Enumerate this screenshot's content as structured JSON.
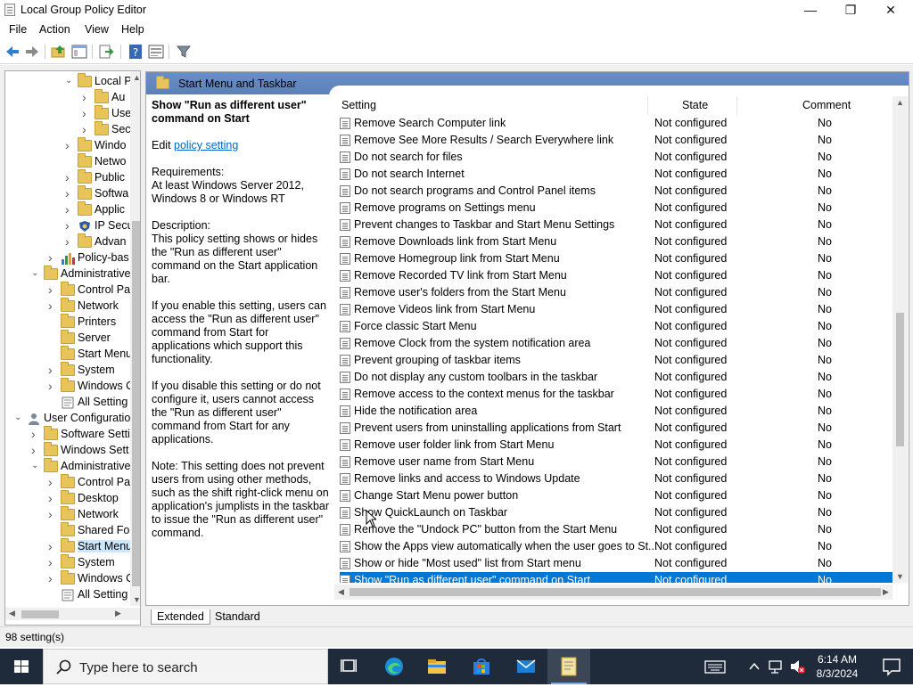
{
  "window": {
    "title": "Local Group Policy Editor",
    "minimize_glyph": "—",
    "maximize_glyph": "❐",
    "close_glyph": "✕"
  },
  "menu": [
    "File",
    "Action",
    "View",
    "Help"
  ],
  "toolbar_icons": [
    "back-icon",
    "forward-icon",
    "up-folder-icon",
    "show-hide-tree-icon",
    "export-list-icon",
    "help-icon",
    "properties-icon",
    "filter-icon"
  ],
  "tree": [
    {
      "label": "Local P",
      "indent": 4,
      "expander": "down",
      "icon": "policy-folder"
    },
    {
      "label": "Au",
      "indent": 5,
      "expander": "right",
      "icon": "lock-folder"
    },
    {
      "label": "Use",
      "indent": 5,
      "expander": "right",
      "icon": "lock-folder"
    },
    {
      "label": "Sec",
      "indent": 5,
      "expander": "right",
      "icon": "lock-folder"
    },
    {
      "label": "Windo",
      "indent": 4,
      "expander": "right",
      "icon": "folder"
    },
    {
      "label": "Netwo",
      "indent": 4,
      "expander": "",
      "icon": "folder"
    },
    {
      "label": "Public",
      "indent": 4,
      "expander": "right",
      "icon": "folder"
    },
    {
      "label": "Softwa",
      "indent": 4,
      "expander": "right",
      "icon": "folder"
    },
    {
      "label": "Applic",
      "indent": 4,
      "expander": "right",
      "icon": "folder"
    },
    {
      "label": "IP Secu",
      "indent": 4,
      "expander": "right",
      "icon": "shield"
    },
    {
      "label": "Advan",
      "indent": 4,
      "expander": "right",
      "icon": "folder"
    },
    {
      "label": "Policy-bas",
      "indent": 3,
      "expander": "right",
      "icon": "chart"
    },
    {
      "label": "Administrative",
      "indent": 2,
      "expander": "down",
      "icon": "folder"
    },
    {
      "label": "Control Pa",
      "indent": 3,
      "expander": "right",
      "icon": "folder"
    },
    {
      "label": "Network",
      "indent": 3,
      "expander": "right",
      "icon": "folder"
    },
    {
      "label": "Printers",
      "indent": 3,
      "expander": "",
      "icon": "folder"
    },
    {
      "label": "Server",
      "indent": 3,
      "expander": "",
      "icon": "folder"
    },
    {
      "label": "Start Menu",
      "indent": 3,
      "expander": "",
      "icon": "folder"
    },
    {
      "label": "System",
      "indent": 3,
      "expander": "right",
      "icon": "folder"
    },
    {
      "label": "Windows C",
      "indent": 3,
      "expander": "right",
      "icon": "folder"
    },
    {
      "label": "All Setting",
      "indent": 3,
      "expander": "",
      "icon": "settings"
    },
    {
      "label": "User Configuration",
      "indent": 1,
      "expander": "down",
      "icon": "user"
    },
    {
      "label": "Software Setti",
      "indent": 2,
      "expander": "right",
      "icon": "folder"
    },
    {
      "label": "Windows Sett",
      "indent": 2,
      "expander": "right",
      "icon": "folder"
    },
    {
      "label": "Administrative",
      "indent": 2,
      "expander": "down",
      "icon": "folder"
    },
    {
      "label": "Control Pa",
      "indent": 3,
      "expander": "right",
      "icon": "folder"
    },
    {
      "label": "Desktop",
      "indent": 3,
      "expander": "right",
      "icon": "folder"
    },
    {
      "label": "Network",
      "indent": 3,
      "expander": "right",
      "icon": "folder"
    },
    {
      "label": "Shared Fol",
      "indent": 3,
      "expander": "",
      "icon": "folder"
    },
    {
      "label": "Start Menu",
      "indent": 3,
      "expander": "right",
      "icon": "folder",
      "selected": true
    },
    {
      "label": "System",
      "indent": 3,
      "expander": "right",
      "icon": "folder"
    },
    {
      "label": "Windows C",
      "indent": 3,
      "expander": "right",
      "icon": "folder"
    },
    {
      "label": "All Setting",
      "indent": 3,
      "expander": "",
      "icon": "settings"
    }
  ],
  "right_header": "Start Menu and Taskbar",
  "description": {
    "title": "Show \"Run as different user\" command on Start",
    "edit_prefix": "Edit",
    "edit_link": "policy setting",
    "requirements": "Requirements:\nAt least Windows Server 2012, Windows 8 or Windows RT",
    "description": "Description:\nThis policy setting shows or hides the \"Run as different user\" command on the Start application bar.",
    "enable": "If you enable this setting, users can access the \"Run as different user\" command from Start for applications which support this functionality.",
    "disable": "If you disable this setting or do not configure it, users cannot access the \"Run as different user\" command from Start for any applications.",
    "note": "Note: This setting does not prevent users from using other methods, such as the shift right-click menu on application's jumplists in the taskbar to issue the \"Run as different user\" command."
  },
  "columns": {
    "setting": "Setting",
    "state": "State",
    "comment": "Comment"
  },
  "settings": [
    {
      "name": "Remove Search Computer link",
      "state": "Not configured",
      "comment": "No"
    },
    {
      "name": "Remove See More Results / Search Everywhere link",
      "state": "Not configured",
      "comment": "No"
    },
    {
      "name": "Do not search for files",
      "state": "Not configured",
      "comment": "No"
    },
    {
      "name": "Do not search Internet",
      "state": "Not configured",
      "comment": "No"
    },
    {
      "name": "Do not search programs and Control Panel items",
      "state": "Not configured",
      "comment": "No"
    },
    {
      "name": "Remove programs on Settings menu",
      "state": "Not configured",
      "comment": "No"
    },
    {
      "name": "Prevent changes to Taskbar and Start Menu Settings",
      "state": "Not configured",
      "comment": "No"
    },
    {
      "name": "Remove Downloads link from Start Menu",
      "state": "Not configured",
      "comment": "No"
    },
    {
      "name": "Remove Homegroup link from Start Menu",
      "state": "Not configured",
      "comment": "No"
    },
    {
      "name": "Remove Recorded TV link from Start Menu",
      "state": "Not configured",
      "comment": "No"
    },
    {
      "name": "Remove user's folders from the Start Menu",
      "state": "Not configured",
      "comment": "No"
    },
    {
      "name": "Remove Videos link from Start Menu",
      "state": "Not configured",
      "comment": "No"
    },
    {
      "name": "Force classic Start Menu",
      "state": "Not configured",
      "comment": "No"
    },
    {
      "name": "Remove Clock from the system notification area",
      "state": "Not configured",
      "comment": "No"
    },
    {
      "name": "Prevent grouping of taskbar items",
      "state": "Not configured",
      "comment": "No"
    },
    {
      "name": "Do not display any custom toolbars in the taskbar",
      "state": "Not configured",
      "comment": "No"
    },
    {
      "name": "Remove access to the context menus for the taskbar",
      "state": "Not configured",
      "comment": "No"
    },
    {
      "name": "Hide the notification area",
      "state": "Not configured",
      "comment": "No"
    },
    {
      "name": "Prevent users from uninstalling applications from Start",
      "state": "Not configured",
      "comment": "No"
    },
    {
      "name": "Remove user folder link from Start Menu",
      "state": "Not configured",
      "comment": "No"
    },
    {
      "name": "Remove user name from Start Menu",
      "state": "Not configured",
      "comment": "No"
    },
    {
      "name": "Remove links and access to Windows Update",
      "state": "Not configured",
      "comment": "No"
    },
    {
      "name": "Change Start Menu power button",
      "state": "Not configured",
      "comment": "No"
    },
    {
      "name": "Show QuickLaunch on Taskbar",
      "state": "Not configured",
      "comment": "No"
    },
    {
      "name": "Remove the \"Undock PC\" button from the Start Menu",
      "state": "Not configured",
      "comment": "No"
    },
    {
      "name": "Show the Apps view automatically when the user goes to St...",
      "state": "Not configured",
      "comment": "No"
    },
    {
      "name": "Show or hide \"Most used\" list from Start menu",
      "state": "Not configured",
      "comment": "No"
    },
    {
      "name": "Show \"Run as different user\" command on Start",
      "state": "Not configured",
      "comment": "No",
      "selected": true
    }
  ],
  "tabs": {
    "extended": "Extended",
    "standard": "Standard"
  },
  "status": "98 setting(s)",
  "taskbar": {
    "search_placeholder": "Type here to search",
    "time": "6:14 AM",
    "date": "8/3/2024"
  }
}
